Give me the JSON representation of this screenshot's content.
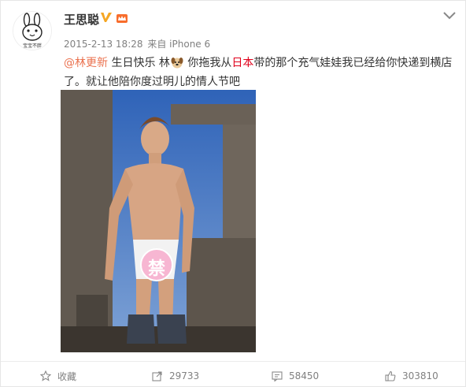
{
  "post": {
    "author": "王思聪",
    "date": "2015-2-13 18:28",
    "source_prefix": "来自",
    "source": "iPhone 6",
    "avatar_caption": "宝宝不胖",
    "content": {
      "mention": "@林更新",
      "part1": " 生日快乐 林",
      "part2": " 你拖我从",
      "highlight": "日本",
      "part3": "带的那个充气娃娃我已经给你快递到横店了。就让他陪你度过明儿的情人节吧"
    },
    "censor_mark": "禁"
  },
  "actions": {
    "favorite": "收藏",
    "repost": "29733",
    "comment": "58450",
    "like": "303810"
  },
  "icons": {
    "verified": "verified-v-icon",
    "level": "member-crown-icon",
    "menu": "chevron-down-icon",
    "emoji": "dog-emoji-icon"
  },
  "colors": {
    "mention": "#eb7350",
    "highlight": "#e0001b",
    "verified": "#f5a623",
    "sky": "#3c72c7"
  }
}
